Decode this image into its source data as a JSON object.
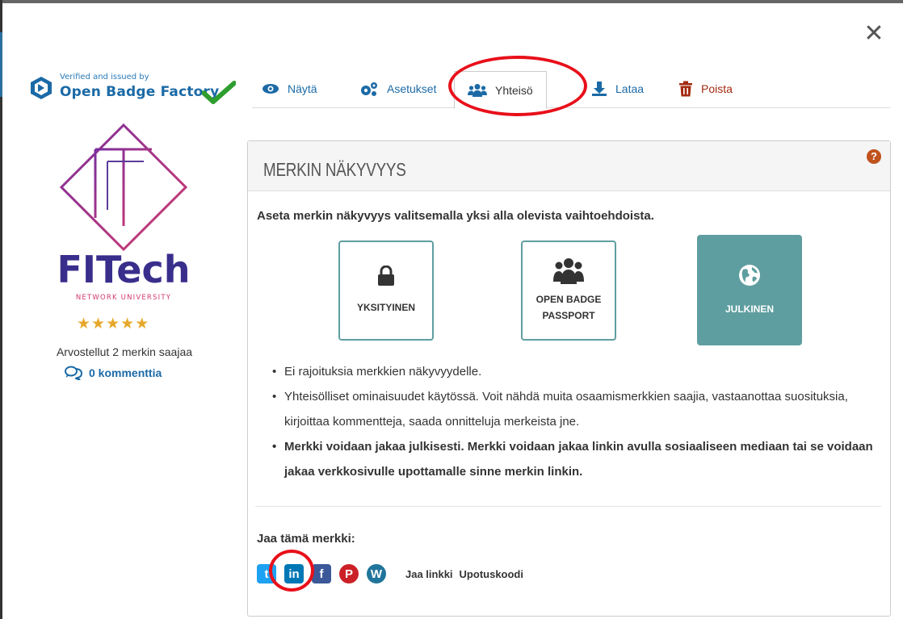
{
  "modal": {
    "close_glyph": "✕"
  },
  "issuer": {
    "verified_label": "Verified and issued by",
    "name": "Open Badge Factory"
  },
  "tabs": [
    {
      "label": "Näytä",
      "icon": "eye-icon"
    },
    {
      "label": "Asetukset",
      "icon": "cogs-icon"
    },
    {
      "label": "Yhteisö",
      "icon": "users-icon",
      "active": true
    },
    {
      "label": "Lataa",
      "icon": "download-icon"
    },
    {
      "label": "Poista",
      "icon": "trash-icon"
    }
  ],
  "badge": {
    "logo_text": "FITech",
    "logo_subtext": "NETWORK UNIVERSITY",
    "rating_stars": 5,
    "star_glyph": "★",
    "reviewed_text": "Arvostellut 2 merkin saajaa",
    "comments_text": "0 kommenttia"
  },
  "visibility": {
    "title": "MERKIN NÄKYVYYS",
    "help_glyph": "?",
    "instruction": "Aseta merkin näkyvyys valitsemalla yksi alla olevista vaihtoehdoista.",
    "options": [
      {
        "label": "YKSITYINEN",
        "icon": "lock-icon"
      },
      {
        "label_line1": "OPEN BADGE",
        "label_line2": "PASSPORT",
        "icon": "users-icon"
      },
      {
        "label": "JULKINEN",
        "icon": "globe-icon",
        "selected": true
      }
    ],
    "bullets": [
      "Ei rajoituksia merkkien näkyvyydelle.",
      "Yhteisölliset ominaisuudet käytössä. Voit nähdä muita osaamismerkkien saajia, vastaanottaa suosituksia, kirjoittaa kommentteja, saada onnitteluja merkeista jne.",
      "Merkki voidaan jakaa julkisesti. Merkki voidaan jakaa linkin avulla sosiaaliseen mediaan tai se voidaan jakaa verkkosivulle upottamalle sinne merkin linkin."
    ]
  },
  "share": {
    "title": "Jaa tämä merkki:",
    "networks": [
      {
        "name": "twitter-icon",
        "glyph": "t",
        "color": "#1da1f2"
      },
      {
        "name": "linkedin-icon",
        "glyph": "in",
        "color": "#0077b5"
      },
      {
        "name": "facebook-icon",
        "glyph": "f",
        "color": "#3b5998"
      },
      {
        "name": "pinterest-icon",
        "glyph": "P",
        "color": "#cb2027"
      },
      {
        "name": "wordpress-icon",
        "glyph": "W",
        "color": "#21759b"
      }
    ],
    "link_label": "Jaa linkki",
    "embed_label": "Upotuskoodi"
  },
  "colors": {
    "primary_link": "#1b6aa6",
    "option_teal": "#5f9ea0",
    "delete_red": "#a32a10",
    "annotation_red": "#e8101a",
    "star": "#e6a82b",
    "logo_purple": "#3a2e8c"
  }
}
